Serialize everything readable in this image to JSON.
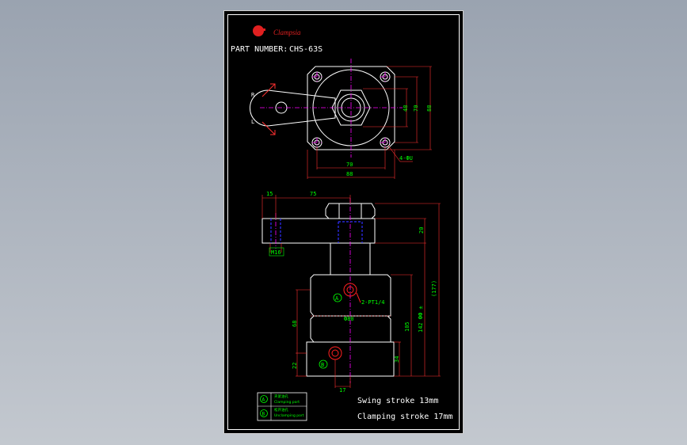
{
  "logo": {
    "brand": "Clampsia"
  },
  "part_number": {
    "label": "PART NUMBER:",
    "value": "CHS-63S"
  },
  "top_view": {
    "rotation_r": "R",
    "rotation_l": "L",
    "dim_48": "48",
    "dim_70_v": "70",
    "dim_88_v": "88",
    "dim_70_h": "70",
    "dim_88_h": "88",
    "bolt_callout": "4-ФU"
  },
  "side_view": {
    "dim_15": "15",
    "dim_75": "75",
    "dim_m16": "M16",
    "dim_20": "20",
    "dim_177": "(177)",
    "dim_142": "142 ФФ ±",
    "dim_105": "105",
    "port_callout": "2-PT1/4",
    "dim_80": "Ф80",
    "dim_68": "68",
    "dim_22": "22",
    "dim_34": "34",
    "dim_17": "17",
    "port_a": "A",
    "port_b": "B"
  },
  "legend": {
    "a_symbol": "A",
    "a_cn": "夹紧油孔",
    "a_en": "Clamping port",
    "b_symbol": "B",
    "b_cn": "松开油孔",
    "b_en": "Unclamping port"
  },
  "notes": {
    "swing": "Swing stroke 13mm",
    "clamping": "Clamping stroke 17mm"
  },
  "colors": {
    "background": "#000000",
    "outline": "#ffffff",
    "dimension": "#00ff00",
    "center_line": "#ff00ff",
    "hidden": "#0000ff",
    "port": "#ff0000",
    "dim_leader": "#ff3030"
  }
}
